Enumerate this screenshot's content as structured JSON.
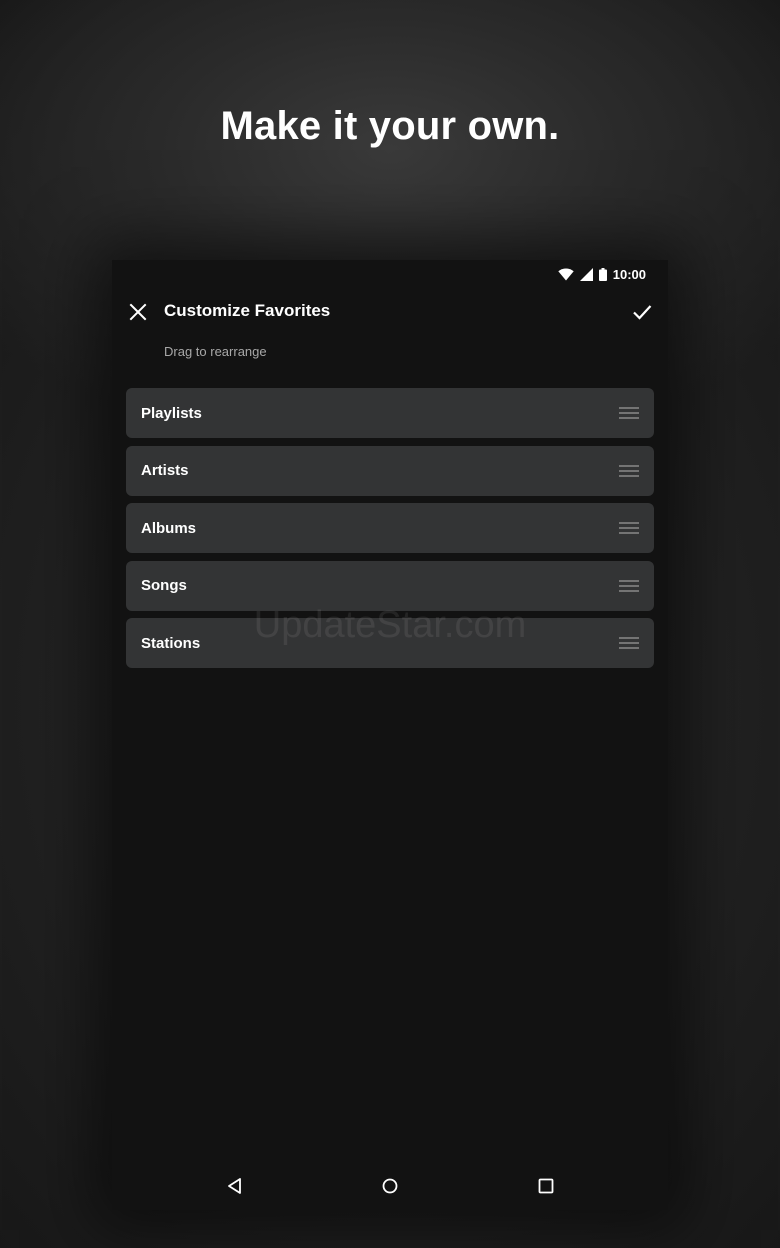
{
  "headline": "Make it your own.",
  "status_bar": {
    "time": "10:00",
    "icons": [
      "wifi-icon",
      "cell-signal-icon",
      "battery-icon"
    ]
  },
  "app_bar": {
    "close_icon": "close-icon",
    "title": "Customize Favorites",
    "confirm_icon": "check-icon"
  },
  "hint": "Drag to rearrange",
  "favorites": [
    {
      "label": "Playlists"
    },
    {
      "label": "Artists"
    },
    {
      "label": "Albums"
    },
    {
      "label": "Songs"
    },
    {
      "label": "Stations"
    }
  ],
  "watermark": "UpdateStar.com",
  "nav_bar": {
    "buttons": [
      "back-icon",
      "home-icon",
      "recents-icon"
    ]
  },
  "colors": {
    "background": "#1a1a1a",
    "screen": "#121212",
    "item": "#333435",
    "text": "#ffffff",
    "secondary_text": "#a8a8a8"
  }
}
